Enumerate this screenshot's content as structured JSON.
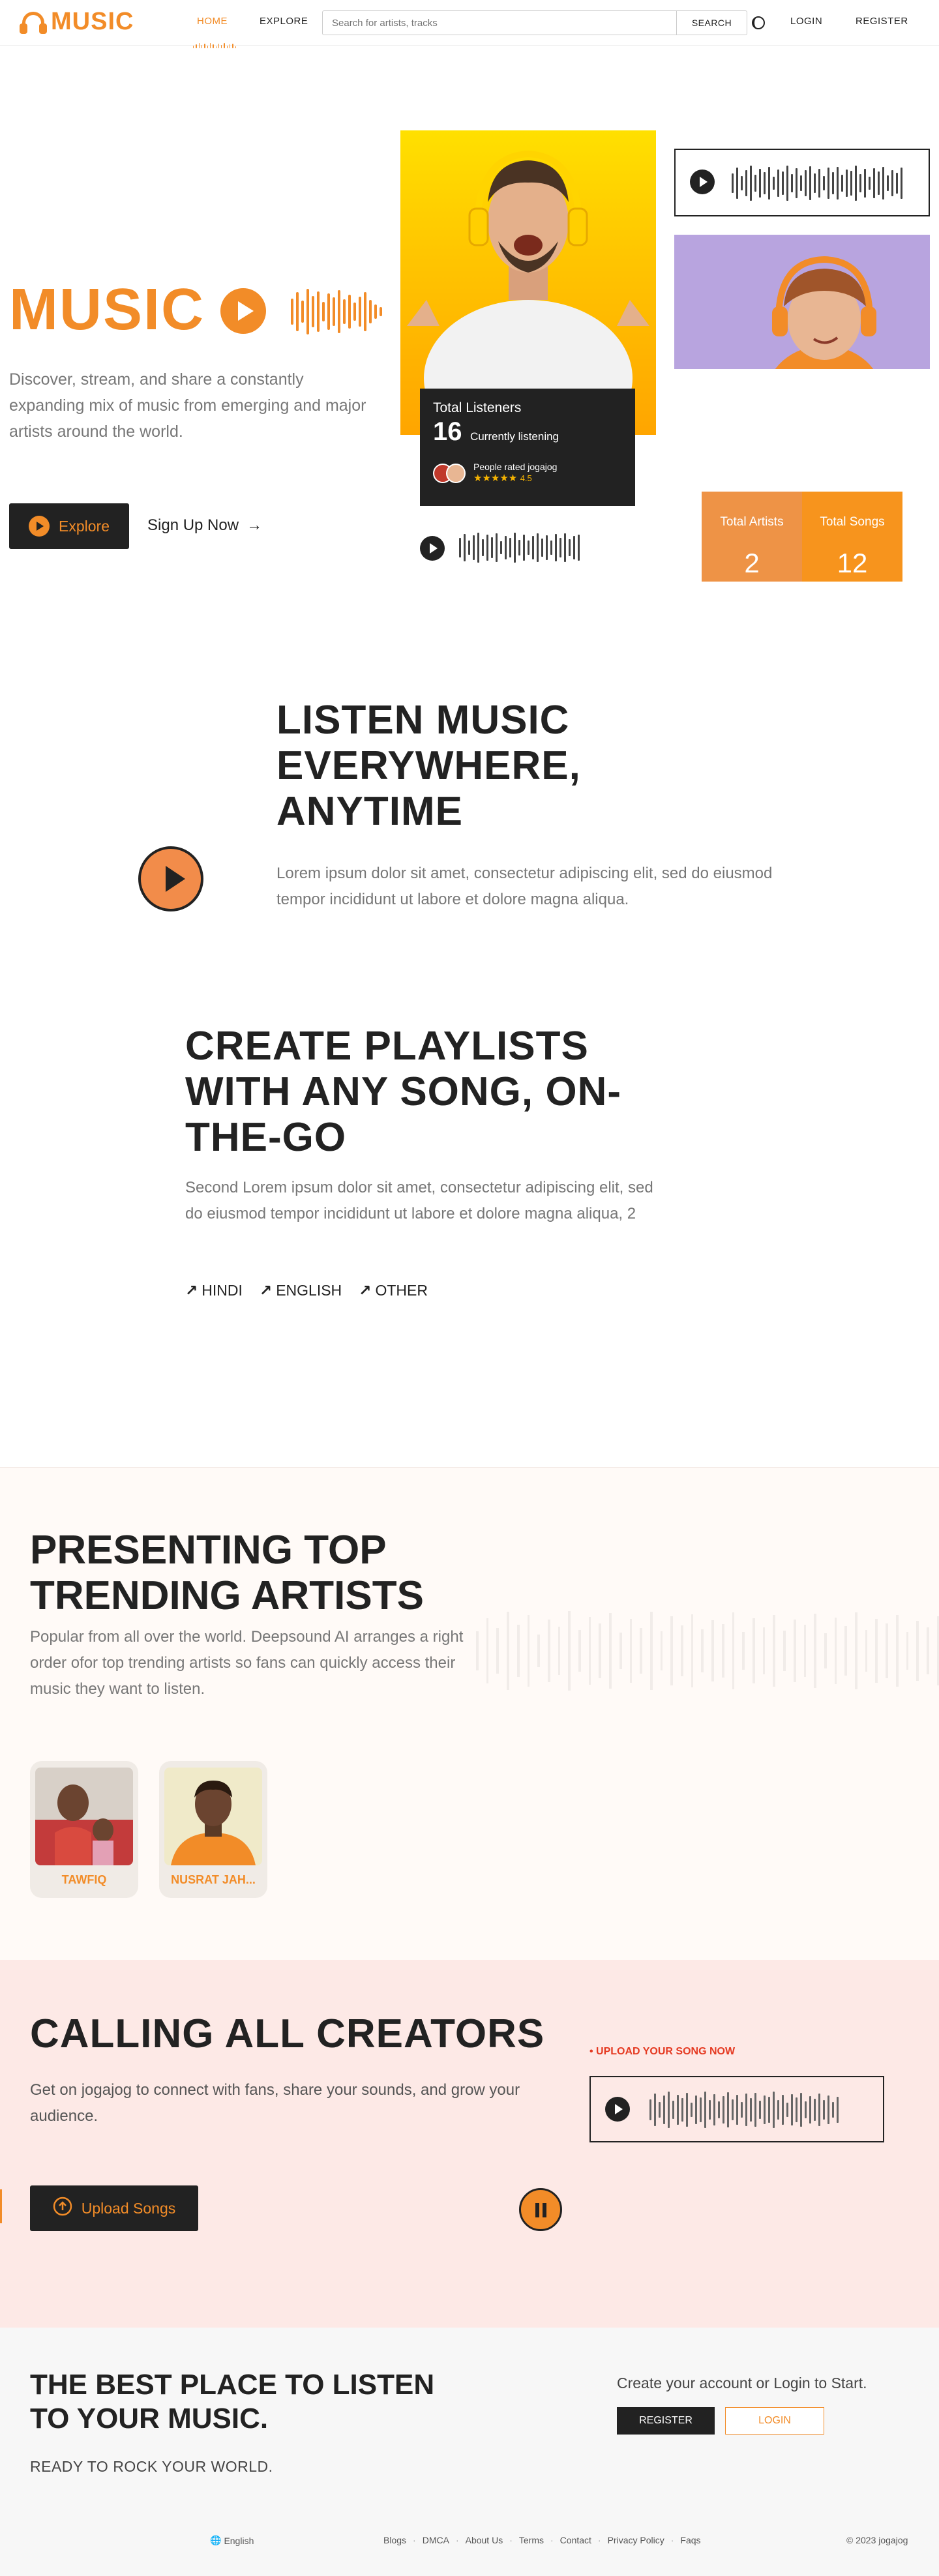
{
  "brand": {
    "name": "MUSIC",
    "accent": "#f28c28",
    "dark": "#222222"
  },
  "nav": {
    "home": "HOME",
    "explore": "EXPLORE",
    "search_placeholder": "Search for artists, tracks",
    "search_button": "SEARCH",
    "login": "LOGIN",
    "register": "REGISTER"
  },
  "hero": {
    "title": "MUSIC",
    "description": "Discover, stream, and share a constantly expanding mix of music from emerging and major artists around the world.",
    "explore": "Explore",
    "signup": "Sign Up Now"
  },
  "listeners": {
    "title": "Total Listeners",
    "count": "16",
    "currently": "Currently listening",
    "rated": "People rated jogajog",
    "stars": "★★★★★",
    "score": "4.5"
  },
  "stats": {
    "artists_label": "Total Artists",
    "artists_value": "2",
    "songs_label": "Total Songs",
    "songs_value": "12"
  },
  "listen": {
    "title": "LISTEN MUSIC EVERYWHERE, ANYTIME",
    "text": "Lorem ipsum dolor sit amet, consectetur adipiscing elit, sed do eiusmod tempor incididunt ut labore et dolore magna aliqua."
  },
  "playlists": {
    "title": "CREATE PLAYLISTS WITH ANY SONG, ON-THE-GO",
    "text": "Second Lorem ipsum dolor sit amet, consectetur adipiscing elit, sed do eiusmod tempor incididunt ut labore et dolore magna aliqua, 2",
    "languages": [
      "HINDI",
      "ENGLISH",
      "OTHER"
    ]
  },
  "artists": {
    "title": "PRESENTING TOP TRENDING ARTISTS",
    "text": "Popular from all over the world. Deepsound AI arranges a right order ofor top trending artists so fans can quickly access their music they want to listen.",
    "items": [
      {
        "name": "TAWFIQ"
      },
      {
        "name": "NUSRAT JAH..."
      }
    ]
  },
  "creators": {
    "title": "CALLING ALL CREATORS",
    "text": "Get on jogajog to connect with fans, share your sounds, and grow your audience.",
    "upload": "Upload Songs",
    "upload_now": "• UPLOAD YOUR SONG NOW"
  },
  "cta": {
    "title": "THE BEST PLACE TO LISTEN TO YOUR MUSIC.",
    "sub": "READY TO ROCK YOUR WORLD.",
    "right": "Create your account or Login to Start.",
    "register": "REGISTER",
    "login": "LOGIN"
  },
  "footer": {
    "language": "English",
    "links": [
      "Blogs",
      "DMCA",
      "About Us",
      "Terms",
      "Contact",
      "Privacy Policy",
      "Faqs"
    ],
    "copyright": "© 2023 jogajog"
  }
}
